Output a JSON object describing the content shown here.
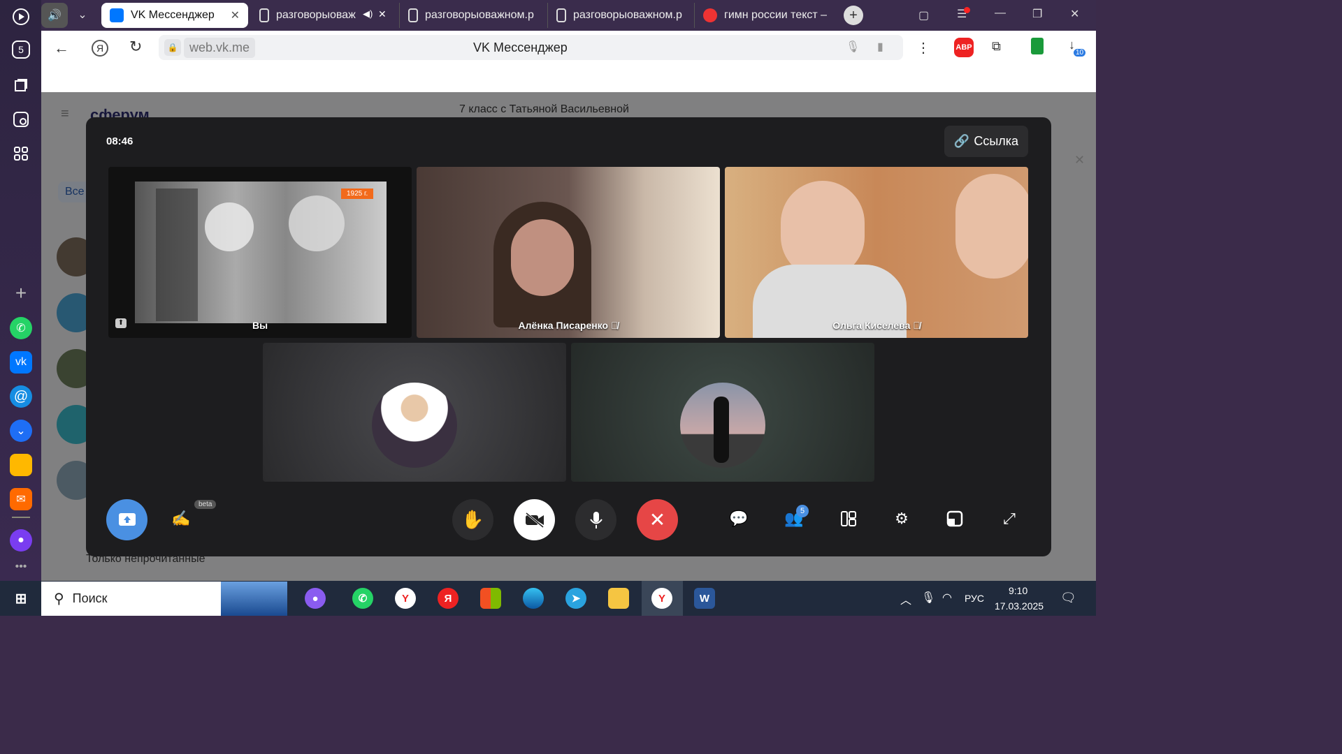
{
  "browser": {
    "tabs": [
      {
        "label": "VK Мессенджер",
        "active": true
      },
      {
        "label": "разговорыоваж"
      },
      {
        "label": "разговорыоважном.p"
      },
      {
        "label": "разговорыоважном.p"
      },
      {
        "label": "гимн россии текст –"
      }
    ],
    "address": "web.vk.me",
    "page_title": "VK Мессенджер",
    "sidebar_badge": "5",
    "downloads_badge": "10",
    "abp_label": "ABP"
  },
  "messenger": {
    "brand": "сферум",
    "chat_title": "7 класс с Татьяной Васильевной",
    "filter_label": "Все",
    "unread_label": "Только непрочитанные"
  },
  "call": {
    "timer": "08:46",
    "link_label": "Ссылка",
    "participants": [
      {
        "name": "Вы",
        "stamp": "1925 г."
      },
      {
        "name": "Алёнка Писаренко"
      },
      {
        "name": "Ольга Киселева"
      }
    ],
    "beta_label": "beta",
    "participants_badge": "5"
  },
  "taskbar": {
    "search_placeholder": "Поиск",
    "lang": "РУС",
    "time": "9:10",
    "date": "17.03.2025"
  },
  "colors": {
    "accent_blue": "#4a90e2",
    "hangup_red": "#e64646",
    "vk_blue": "#0077ff"
  }
}
